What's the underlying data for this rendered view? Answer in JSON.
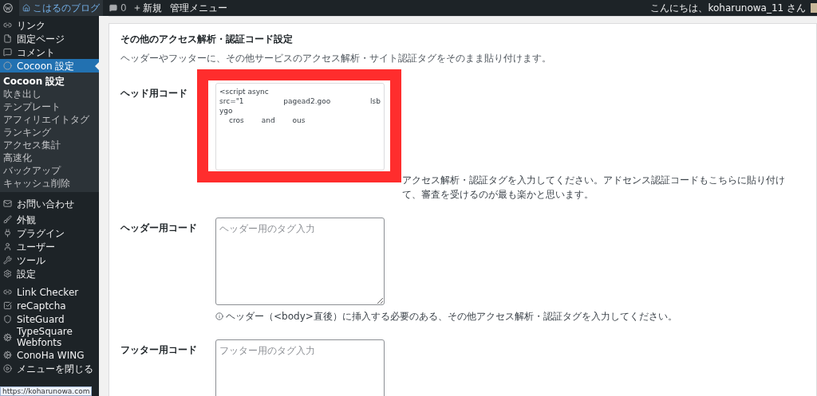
{
  "admin_bar": {
    "site": "こはるのブログ",
    "comments": "0",
    "new": "新規",
    "admin_menu": "管理メニュー",
    "greeting": "こんにちは、koharunowa_11 さん"
  },
  "sidebar": {
    "items": [
      {
        "label": "リンク",
        "selected": false
      },
      {
        "label": "固定ページ",
        "selected": false
      },
      {
        "label": "コメント",
        "selected": false
      },
      {
        "label": "Cocoon 設定",
        "selected": true,
        "children": [
          {
            "label": "Cocoon 設定",
            "selected": true
          },
          {
            "label": "吹き出し",
            "selected": false
          },
          {
            "label": "テンプレート",
            "selected": false
          },
          {
            "label": "アフィリエイトタグ",
            "selected": false
          },
          {
            "label": "ランキング",
            "selected": false
          },
          {
            "label": "アクセス集計",
            "selected": false
          },
          {
            "label": "高速化",
            "selected": false
          },
          {
            "label": "バックアップ",
            "selected": false
          },
          {
            "label": "キャッシュ削除",
            "selected": false
          }
        ]
      },
      {
        "label": "お問い合わせ",
        "selected": false
      },
      {
        "label": "外観",
        "selected": false
      },
      {
        "label": "プラグイン",
        "selected": false
      },
      {
        "label": "ユーザー",
        "selected": false
      },
      {
        "label": "ツール",
        "selected": false
      },
      {
        "label": "設定",
        "selected": false
      },
      {
        "label": "Link Checker",
        "selected": false
      },
      {
        "label": "reCaptcha",
        "selected": false
      },
      {
        "label": "SiteGuard",
        "selected": false
      },
      {
        "label": "TypeSquare Webfonts",
        "selected": false
      },
      {
        "label": "ConoHa WING",
        "selected": false
      },
      {
        "label": "メニューを閉じる",
        "selected": false
      }
    ],
    "status_url": "https://koharunowa.com"
  },
  "section": {
    "title": "その他のアクセス解析・認証コード設定",
    "description": "ヘッダーやフッターに、その他サービスのアクセス解析・サイト認証タグをそのまま貼り付けます。",
    "fields": [
      {
        "label": "ヘッド用コード",
        "value_lines": [
          [
            "<script async"
          ],
          [
            "src=\"1",
            "pagead2.goo",
            "lsb"
          ],
          [
            "ygo"
          ],
          [
            "cros",
            "and",
            "ous"
          ]
        ],
        "highlighted": true,
        "help": "アクセス解析・認証タグを入力してください。アドセンス認証コードもこちらに貼り付けて、審査を受けるのが最も楽かと思います。"
      },
      {
        "label": "ヘッダー用コード",
        "placeholder": "ヘッダー用のタグ入力",
        "highlighted": false,
        "help": "ヘッダー（<body>直後）に挿入する必要のある、その他アクセス解析・認証タグを入力してください。"
      },
      {
        "label": "フッター用コード",
        "placeholder": "フッター用のタグ入力",
        "highlighted": false
      }
    ]
  }
}
